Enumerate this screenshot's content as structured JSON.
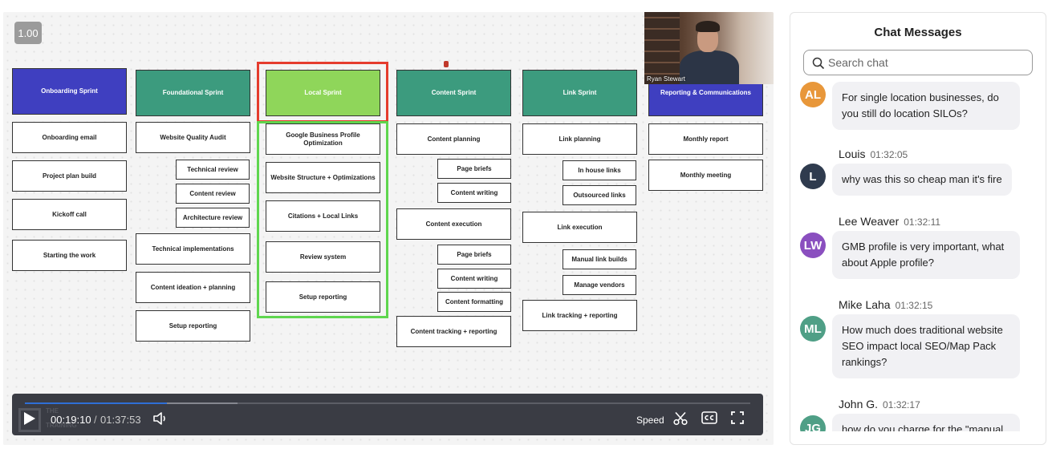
{
  "player": {
    "speed_badge": "1.00",
    "presenter_name": "Ryan Stewart",
    "current_time": "00:19:10",
    "time_separator": "/",
    "total_time": "01:37:53",
    "progress_fraction": 0.196,
    "buffer_fraction": 0.293,
    "speed_label": "Speed",
    "watermark_text": "THE\n\nTRAINING"
  },
  "board": {
    "columns": [
      {
        "header": "Onboarding Sprint",
        "color": "#3f3fc0",
        "items": [
          "Onboarding email",
          "Project plan build",
          "Kickoff call",
          "Starting the work"
        ]
      },
      {
        "header": "Foundational Sprint",
        "color": "#3c9b7e",
        "items": [
          "Website Quality Audit",
          "Technical review",
          "Content review",
          "Architecture review",
          "Technical implementations",
          "Content ideation + planning",
          "Setup reporting"
        ]
      },
      {
        "header": "Local Sprint",
        "color": "#8fd65a",
        "items": [
          "Google Business Profile Optimization",
          "Website Structure + Optimizations",
          "Citations + Local Links",
          "Review system",
          "Setup reporting"
        ]
      },
      {
        "header": "Content Sprint",
        "color": "#3c9b7e",
        "items": [
          "Content planning",
          "Page briefs",
          "Content writing",
          "Content execution",
          "Page briefs",
          "Content writing",
          "Content formatting",
          "Content tracking + reporting"
        ]
      },
      {
        "header": "Link Sprint",
        "color": "#3c9b7e",
        "items": [
          "Link planning",
          "In house links",
          "Outsourced links",
          "Link execution",
          "Manual link builds",
          "Manage vendors",
          "Link tracking + reporting"
        ]
      },
      {
        "header": "Reporting & Communications",
        "color": "#3f3fc0",
        "items": [
          "Monthly report",
          "Monthly meeting"
        ]
      }
    ]
  },
  "chat": {
    "title": "Chat Messages",
    "search_placeholder": "Search chat",
    "messages": [
      {
        "initials": "AL",
        "color": "#e8973a",
        "author": "",
        "time": "",
        "text": "For single location businesses, do you still do location SILOs?"
      },
      {
        "initials": "L",
        "color": "#2f3b4e",
        "author": "Louis",
        "time": "01:32:05",
        "text": "why was this so cheap man it's fire"
      },
      {
        "initials": "LW",
        "color": "#8a4fbf",
        "author": "Lee Weaver",
        "time": "01:32:11",
        "text": "GMB profile is very important, what about Apple profile?"
      },
      {
        "initials": "ML",
        "color": "#4f9f86",
        "author": "Mike Laha",
        "time": "01:32:15",
        "text": "How much does traditional website SEO impact local SEO/Map Pack rankings?"
      },
      {
        "initials": "JG",
        "color": "#4f9f86",
        "author": "John G.",
        "time": "01:32:17",
        "text": "how do you charge for the \"manual"
      }
    ]
  }
}
